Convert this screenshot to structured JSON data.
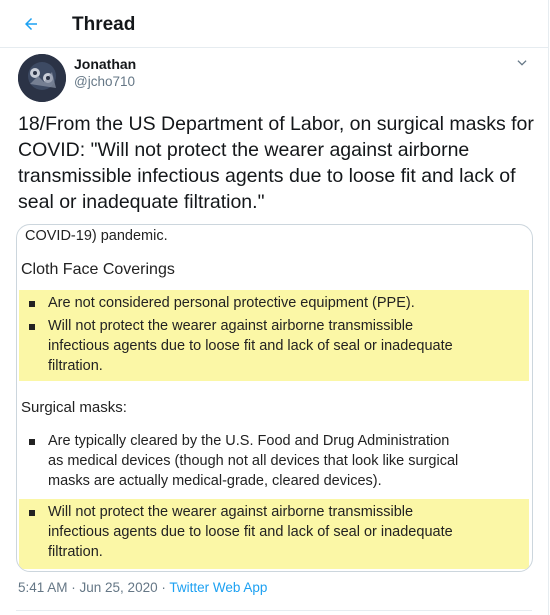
{
  "header": {
    "title": "Thread",
    "back_icon": "arrow-left-icon",
    "accent": "#1da1f2"
  },
  "tweet": {
    "display_name": "Jonathan",
    "handle": "@jcho710",
    "text": "18/From the US Department of Labor, on surgical masks for COVID: \"Will not protect the wearer against airborne transmissible infectious agents due to loose fit and lack of seal or inadequate filtration.\"",
    "more_icon": "chevron-down-icon",
    "timestamp": "5:41 AM · Jun 25, 2020",
    "separator": " · ",
    "source": "Twitter Web App"
  },
  "media": {
    "top_text": "COVID-19) pandemic.",
    "section1": {
      "heading": "Cloth Face Coverings",
      "bullets": [
        "Are not considered personal protective equipment (PPE).",
        "Will not protect the wearer against airborne transmissible\ninfectious agents due to loose fit and lack of seal or inadequate\nfiltration."
      ]
    },
    "section2": {
      "heading": "Surgical masks:",
      "bullets": [
        "Are typically cleared by the U.S. Food and Drug Administration\nas medical devices (though not all devices that look like surgical\nmasks are actually medical-grade, cleared devices).",
        "Will not protect the wearer against airborne transmissible\ninfectious agents due to loose fit and lack of seal or inadequate\nfiltration."
      ]
    },
    "highlight_color": "#fbf7a6"
  }
}
